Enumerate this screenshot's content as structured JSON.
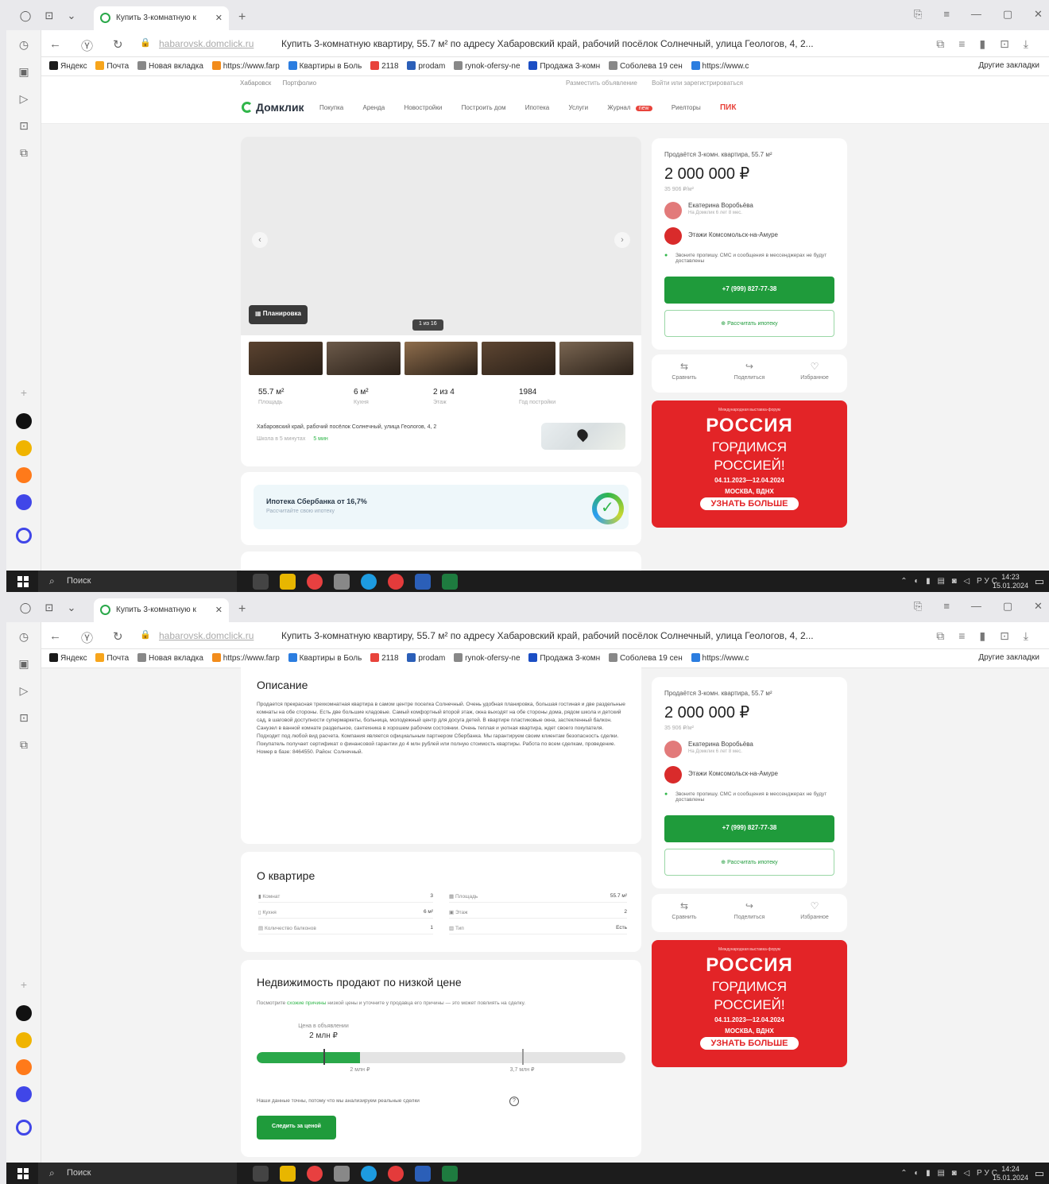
{
  "browser": {
    "tab_title": "Купить 3-комнатную к",
    "url_host": "habarovsk.domclick.ru",
    "page_title": "Купить 3-комнатную квартиру, 55.7 м² по адресу Хабаровский край, рабочий посёлок Солнечный, улица Геологов, 4, 2...",
    "bookmarks": [
      "Яндекс",
      "Почта",
      "Новая вкладка",
      "https://www.farp",
      "Квартиры в Боль",
      "2118",
      "prodam",
      "rynok-ofersy-ne",
      "Продажа 3-комн",
      "Соболева 19 сен",
      "https://www.c"
    ],
    "bookmarks_other": "Другие закладки",
    "bookmark_colors": [
      "#1a1a1a",
      "#f7a51c",
      "#888888",
      "#f28c1c",
      "#2b7de0",
      "#e8433b",
      "#2b5fb8",
      "#888888",
      "#1b4ec4",
      "#888888",
      "#2b7de0"
    ]
  },
  "taskbar": {
    "search": "Поиск",
    "lang": "РУС",
    "time1": "14:23",
    "time2": "14:24",
    "date": "15.01.2024"
  },
  "site": {
    "logo": "Домклик",
    "subnav": [
      "Хабаровск",
      "Портфолио"
    ],
    "subnav_right": [
      "Разместить объявление",
      "Войти или зарегистрироваться"
    ],
    "nav": [
      "Покупка",
      "Аренда",
      "Новостройки",
      "Построить дом",
      "Ипотека",
      "Услуги",
      "Журнал",
      "Риелторы"
    ],
    "nav_badge": "new",
    "pik": "ПИК"
  },
  "gallery": {
    "plan_button": "Планировка",
    "counter": "1 из 16",
    "thumb_colors": [
      "#5b4330",
      "#6c5a4a",
      "#8e6d4c",
      "#5e4632",
      "#7a6652"
    ]
  },
  "stats": [
    {
      "value": "55.7 м²",
      "label": "Площадь"
    },
    {
      "value": "6 м²",
      "label": "Кухня"
    },
    {
      "value": "2 из 4",
      "label": "Этаж"
    },
    {
      "value": "1984",
      "label": "Год постройки"
    }
  ],
  "address": "Хабаровский край, рабочий посёлок Солнечный, улица Геологов, 4, 2",
  "address_extra": "Школа в 5 минутах",
  "address_extra_b": "5 мин",
  "mortgage": {
    "title": "Ипотека Сбербанка от 16,7%",
    "subtitle": "Рассчитайте свою ипотеку"
  },
  "sidecard": {
    "header": "Продаётся 3-комн. квартира, 55.7 м²",
    "price": "2 000 000 ₽",
    "price_per_m": "35 906 ₽/м²",
    "agent": "Екатерина Воробьёва",
    "agent_sub": "На Домклик 6 лет 8 мес.",
    "agency": "Этажи Комсомольск-на-Амуре",
    "note": "Звоните пропишу. СМС и сообщения в мессенджерах не будут доставлены",
    "call": "+7 (999) 827-77-38",
    "calc": "Рассчитать ипотеку"
  },
  "actions": [
    {
      "icon": "⇆",
      "label": "Сравнить"
    },
    {
      "icon": "↪",
      "label": "Поделиться"
    },
    {
      "icon": "♡",
      "label": "Избранное"
    }
  ],
  "ad": {
    "top": "Международная выставка-форум",
    "title": "РОССИЯ",
    "line1": "ГОРДИМСЯ",
    "line2": "РОССИЕЙ!",
    "dates": "04.11.2023—12.04.2024",
    "place": "МОСКВА, ВДНХ",
    "more": "УЗНАТЬ БОЛЬШЕ"
  },
  "description": {
    "title": "Описание",
    "text": "Продается прекрасная трехкомнатная квартира в самом центре поселка Солнечный. Очень удобная планировка, большая гостиная и две раздельные комнаты на обе стороны. Есть две большие кладовые. Самый комфортный второй этаж, окна выходят на обе стороны дома, рядом школа и детский сад, в шаговой доступности супермаркеты, больница, молодежный центр для досуга детей. В квартире пластиковые окна, застекленный балкон. Санузел в ванной комнате раздельное, сантехника в хорошем рабочем состоянии. Очень теплая и уютная квартира, ждет своего покупателя. Подходит под любой вид расчета. Компания является официальным партнером Сбербанка. Мы гарантируем своим клиентам безопасность сделки. Покупатель получает сертификат о финансовой гарантии до 4 млн рублей или полную стоимость квартиры. Работа по всем сделкам, проведение. Номер в базе: 8464550. Район: Солнечный."
  },
  "about": {
    "title": "О квартире",
    "rows": [
      {
        "label": "Комнат",
        "value": "3"
      },
      {
        "label": "Площадь",
        "value": "55.7 м²"
      },
      {
        "label": "Кухня",
        "value": "6 м²"
      },
      {
        "label": "Этаж",
        "value": "2"
      },
      {
        "label": "Количество балконов",
        "value": "1"
      },
      {
        "label": "Тип",
        "value": "Есть"
      }
    ]
  },
  "lowprice": {
    "title": "Недвижимость продают по низкой цене",
    "sub_a": "Посмотрите ",
    "sub_link": "схожие причины",
    "sub_b": " низкой цены и уточните у продавца его причины — это может повлиять на сделку.",
    "price_label": "Цена в объявлении",
    "price": "2 млн ₽",
    "tick1": "2 млн ₽",
    "tick2": "3,7 млн ₽",
    "fill_fraction": 0.28,
    "marker_fraction": 0.18,
    "marker2_fraction": 0.72,
    "note": "Наши данные точны, потому что мы анализируем реальные сделки",
    "button": "Следить за ценой"
  },
  "colors": {
    "green": "#1f9b3b",
    "red": "#e32427",
    "accent_logo": "#30b64a"
  }
}
